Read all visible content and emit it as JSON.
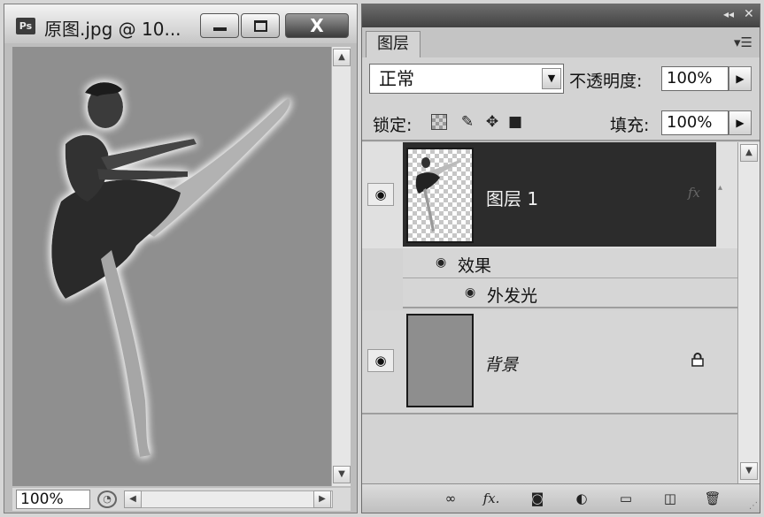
{
  "document_window": {
    "app_logo": "Ps",
    "title": "原图.jpg @ 10...",
    "controls": [
      "minimize-icon",
      "maximize-icon",
      "close-icon"
    ],
    "close_glyph": "X",
    "zoom": "100%",
    "canvas_background": "#8f8f8f"
  },
  "layers_panel": {
    "tab_label": "图层",
    "blend_mode": "正常",
    "opacity_label": "不透明度:",
    "opacity_value": "100%",
    "lock_label": "锁定:",
    "fill_label": "填充:",
    "fill_value": "100%",
    "layers": [
      {
        "name": "图层 1",
        "selected": true,
        "visible": true,
        "has_effects": true,
        "effects_group_label": "效果",
        "effects": [
          "外发光"
        ]
      },
      {
        "name": "背景",
        "selected": false,
        "visible": true,
        "locked": true
      }
    ],
    "footer_icons": [
      "link-layers-icon",
      "fx-icon",
      "layer-mask-icon",
      "adjustment-layer-icon",
      "new-group-icon",
      "new-layer-icon",
      "delete-layer-icon"
    ]
  },
  "colors": {
    "selected_layer_row": "#2c2c2c",
    "panel_bg": "#d3d3d3",
    "background_layer_thumb": "#8e8e8e"
  }
}
